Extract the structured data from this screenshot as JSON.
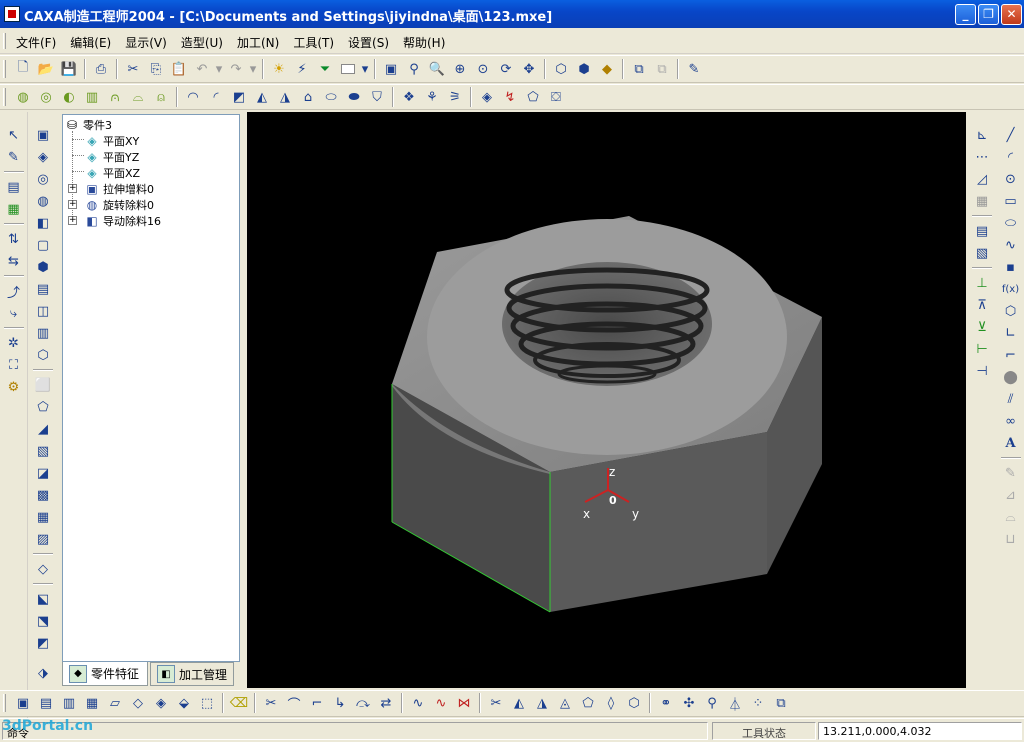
{
  "window": {
    "title": "CAXA制造工程师2004  - [C:\\Documents and Settings\\jiyindna\\桌面\\123.mxe]",
    "minimize": "_",
    "restore": "❐",
    "close": "✕"
  },
  "menu": [
    "文件(F)",
    "编辑(E)",
    "显示(V)",
    "造型(U)",
    "加工(N)",
    "工具(T)",
    "设置(S)",
    "帮助(H)"
  ],
  "tree": {
    "root": "零件3",
    "items": [
      {
        "label": "平面XY",
        "icon": "plane-icon"
      },
      {
        "label": "平面YZ",
        "icon": "plane-icon"
      },
      {
        "label": "平面XZ",
        "icon": "plane-icon"
      },
      {
        "label": "拉伸增料0",
        "icon": "extrude-icon"
      },
      {
        "label": "旋转除料0",
        "icon": "revolve-cut-icon"
      },
      {
        "label": "导动除料16",
        "icon": "sweep-cut-icon"
      }
    ]
  },
  "tabs": [
    {
      "label": "零件特征",
      "active": true
    },
    {
      "label": "加工管理",
      "active": false
    }
  ],
  "viewport": {
    "axis_labels": {
      "z": "z",
      "x": "x",
      "y": "y",
      "origin": "0"
    },
    "background": "#000000"
  },
  "status": {
    "command_label": "命令",
    "tool_state": "工具状态",
    "coordinates": "13.211,0.000,4.032"
  },
  "watermark": "3dPortal.cn",
  "colors": {
    "titlebar": "#0a4fd0",
    "chrome": "#ece9d8",
    "model": "#8a8a8a",
    "edge_highlight": "#33cc33",
    "axis": "#cc2222"
  }
}
